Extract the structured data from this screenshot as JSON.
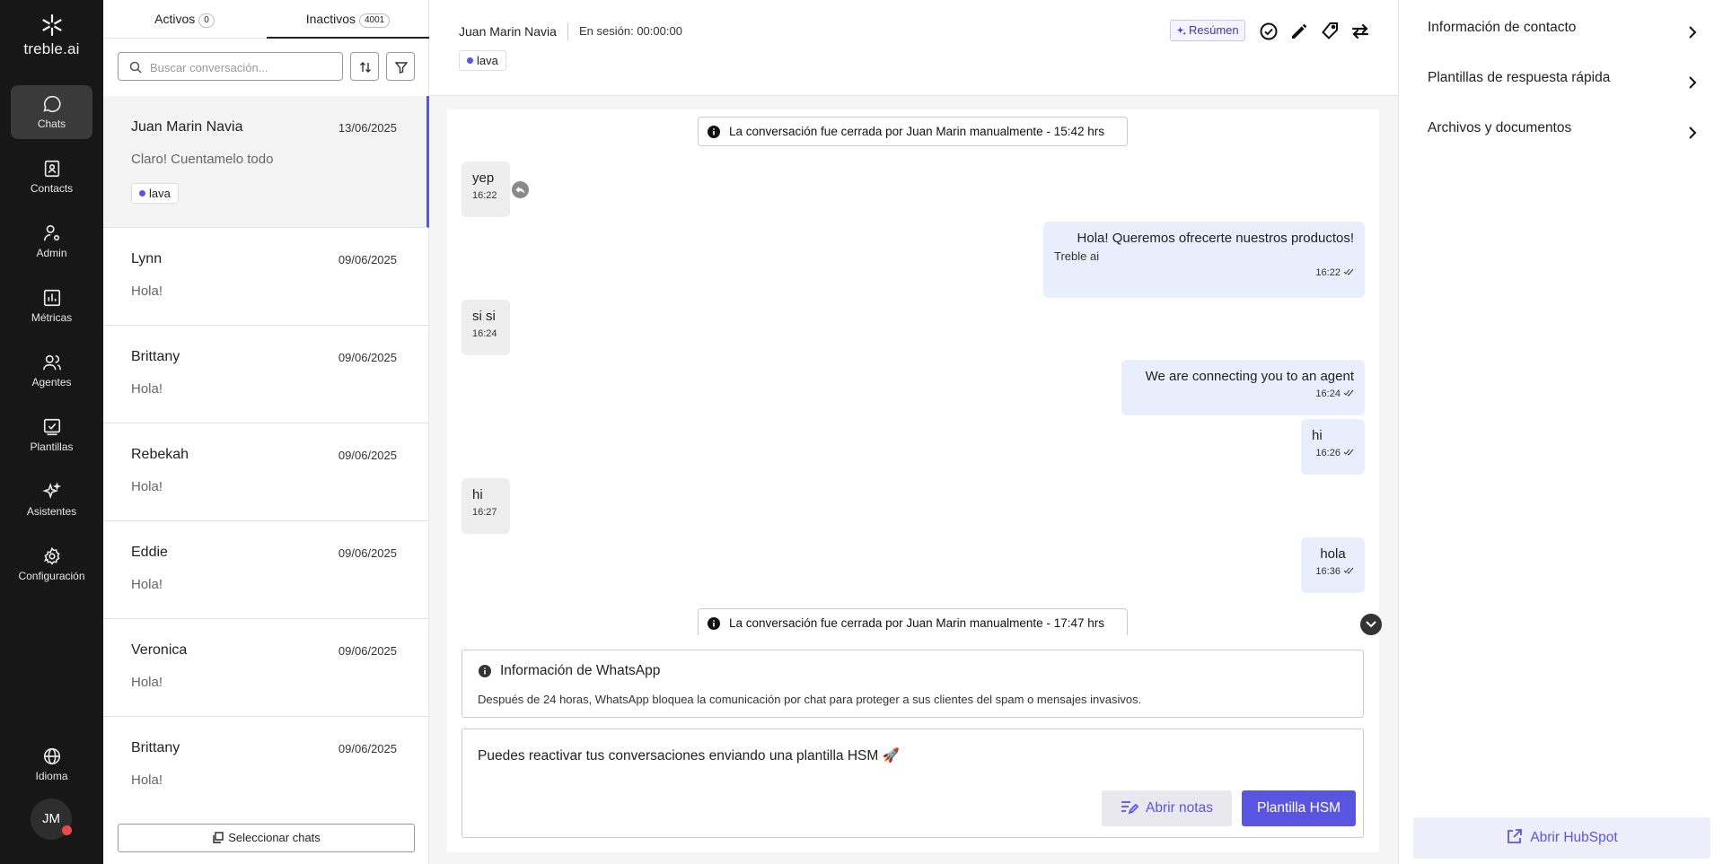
{
  "app": {
    "logo_text": "treble.ai"
  },
  "nav": {
    "items": [
      {
        "id": "chats",
        "label": "Chats",
        "active": true
      },
      {
        "id": "contacts",
        "label": "Contacts"
      },
      {
        "id": "admin",
        "label": "Admin"
      },
      {
        "id": "metricas",
        "label": "Métricas"
      },
      {
        "id": "agentes",
        "label": "Agentes"
      },
      {
        "id": "plantillas",
        "label": "Plantillas"
      },
      {
        "id": "asistentes",
        "label": "Asistentes"
      },
      {
        "id": "configuracion",
        "label": "Configuración"
      }
    ],
    "language_label": "Idioma",
    "avatar_initials": "JM"
  },
  "list": {
    "tabs": [
      {
        "label": "Activos",
        "count": "0"
      },
      {
        "label": "Inactivos",
        "count": "4001",
        "active": true
      }
    ],
    "search_placeholder": "Buscar conversación...",
    "conversations": [
      {
        "name": "Juan Marin Navia",
        "date": "13/06/2025",
        "preview": "Claro! Cuentamelo todo",
        "tag": "lava"
      },
      {
        "name": "Lynn",
        "date": "09/06/2025",
        "preview": "Hola!"
      },
      {
        "name": "Brittany",
        "date": "09/06/2025",
        "preview": "Hola!"
      },
      {
        "name": "Rebekah",
        "date": "09/06/2025",
        "preview": "Hola!"
      },
      {
        "name": "Eddie",
        "date": "09/06/2025",
        "preview": "Hola!"
      },
      {
        "name": "Veronica",
        "date": "09/06/2025",
        "preview": "Hola!"
      },
      {
        "name": "Brittany",
        "date": "09/06/2025",
        "preview": "Hola!"
      }
    ],
    "select_label": "Seleccionar chats"
  },
  "chat": {
    "contact_name": "Juan Marin Navia",
    "session": "En sesión: 00:00:00",
    "tag": "lava",
    "resumen_label": "Resúmen",
    "system_messages": [
      "La conversación fue cerrada por Juan Marin manualmente - 15:42 hrs",
      "La conversación fue cerrada por Juan Marin manualmente - 17:47 hrs"
    ],
    "messages": [
      {
        "dir": "in",
        "text": "yep",
        "time": "16:22"
      },
      {
        "dir": "out",
        "text": "Hola! Queremos ofrecerte nuestros productos!",
        "sub": "Treble ai",
        "time": "16:22"
      },
      {
        "dir": "in",
        "text": "si si",
        "time": "16:24"
      },
      {
        "dir": "out",
        "text": "We are connecting you to an agent",
        "time": "16:24"
      },
      {
        "dir": "out",
        "text": "hi",
        "time": "16:26"
      },
      {
        "dir": "in",
        "text": "hi",
        "time": "16:27"
      },
      {
        "dir": "out",
        "text": "hola",
        "time": "16:36"
      }
    ],
    "whatsapp_info": {
      "title": "Información de WhatsApp",
      "desc": "Después de 24 horas, WhatsApp bloquea la comunicación por chat para proteger a sus clientes del spam o mensajes invasivos."
    },
    "compose": {
      "message": "Puedes reactivar tus conversaciones enviando una plantilla HSM 🚀",
      "notes_label": "Abrir notas",
      "hsm_label": "Plantilla HSM"
    }
  },
  "right_panel": {
    "items": [
      "Información de contacto",
      "Plantillas de respuesta rápida",
      "Archivos y documentos"
    ],
    "hubspot_label": "Abrir HubSpot"
  },
  "colors": {
    "accent": "#5a55e0",
    "rail_bg": "#171717",
    "outgoing_bubble": "#e8eefc",
    "incoming_bubble": "#eeeeee"
  }
}
